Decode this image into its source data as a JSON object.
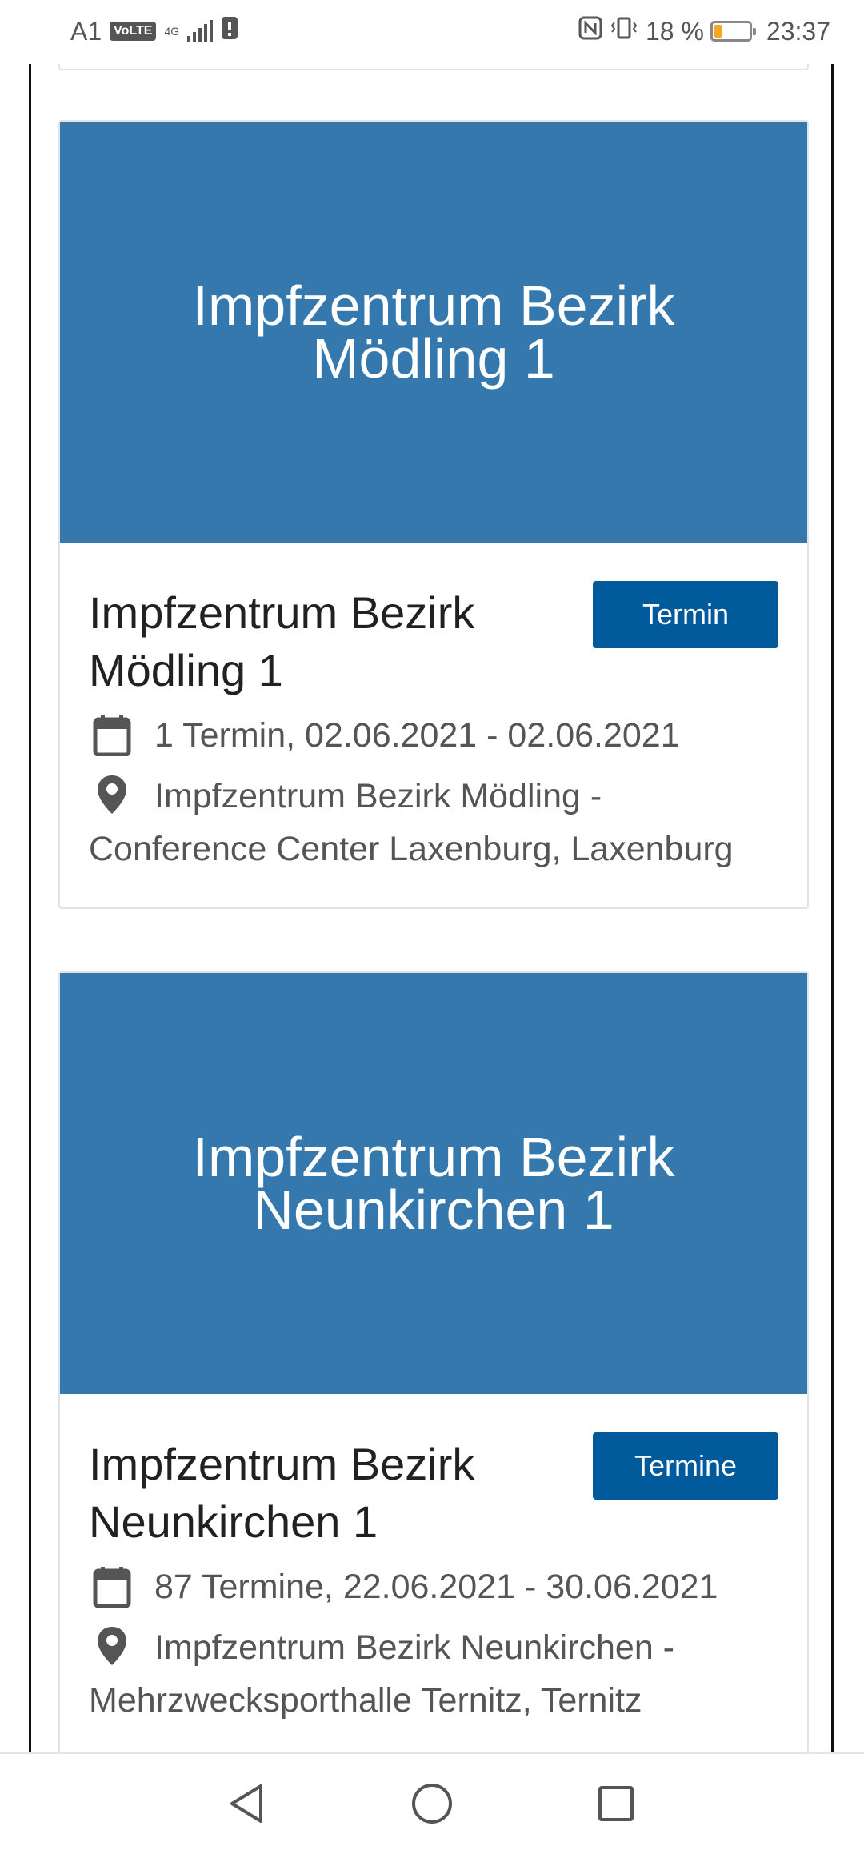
{
  "status_bar": {
    "carrier": "A1",
    "volte": "VoLTE",
    "network": "4G",
    "battery_percent": "18 %",
    "time": "23:37",
    "battery_level": 0.18
  },
  "cards": [
    {
      "hero_title": "Impfzentrum Bezirk Mödling 1",
      "title": "Impfzentrum Bezirk Mödling 1",
      "button_label": "Termin",
      "dates": "1 Termin, 02.06.2021 - 02.06.2021",
      "location": "Impfzentrum Bezirk Mödling - Conference Center Laxenburg, Laxenburg",
      "calendar_icon": "calendar-icon",
      "location_icon": "location-pin-icon"
    },
    {
      "hero_title": "Impfzentrum Bezirk Neunkirchen 1",
      "title": "Impfzentrum Bezirk Neunkirchen 1",
      "button_label": "Termine",
      "dates": "87 Termine, 22.06.2021 - 30.06.2021",
      "location": "Impfzentrum Bezirk Neunkirchen - Mehrzwecksporthalle Ternitz, Ternitz",
      "calendar_icon": "calendar-icon",
      "location_icon": "location-pin-icon"
    }
  ],
  "nav_bar": {
    "back_icon": "back-triangle-icon",
    "home_icon": "home-circle-icon",
    "recents_icon": "recents-square-icon"
  },
  "colors": {
    "hero": "#3478ae",
    "button": "#005a9c",
    "battery_low": "#f5a623"
  }
}
